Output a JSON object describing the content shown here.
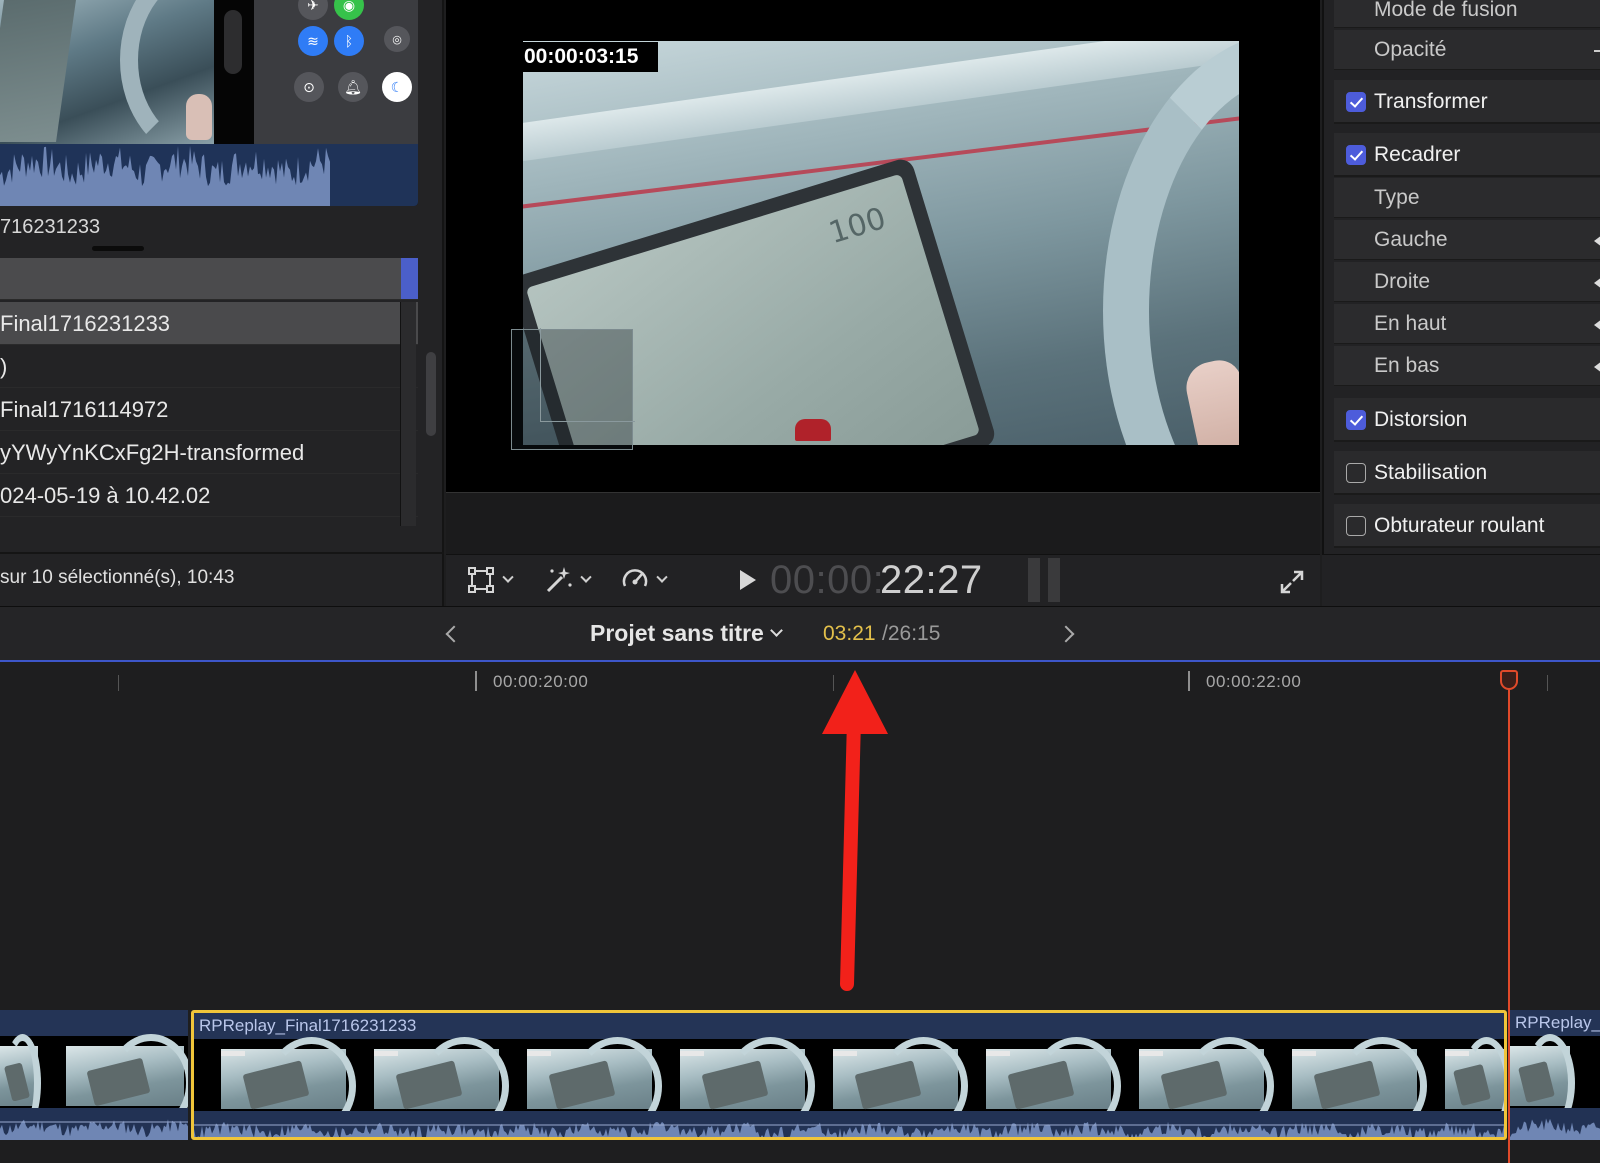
{
  "browser": {
    "clip_name": "716231233",
    "list_items": [
      {
        "label": "Final1716231233",
        "selected": true
      },
      {
        "label": ")",
        "selected": false
      },
      {
        "label": "Final1716114972",
        "selected": false
      },
      {
        "label": "yYWyYnKCxFg2H-transformed",
        "selected": false
      },
      {
        "label": "024-05-19 à 10.42.02",
        "selected": false
      }
    ],
    "status": "sur 10 sélectionné(s), 10:43"
  },
  "viewer": {
    "overlay_timecode": "00:00:03:15",
    "speed_readout": "100",
    "timecode_dim": "00:00:",
    "timecode_bright": "22:27"
  },
  "inspector": {
    "rows": [
      {
        "label": "Mode de fusion",
        "type": "sub"
      },
      {
        "label": "Opacité",
        "type": "sub"
      },
      {
        "label": "Transformer",
        "type": "section",
        "checked": true
      },
      {
        "label": "Recadrer",
        "type": "section",
        "checked": true
      },
      {
        "label": "Type",
        "type": "sub"
      },
      {
        "label": "Gauche",
        "type": "sub"
      },
      {
        "label": "Droite",
        "type": "sub"
      },
      {
        "label": "En haut",
        "type": "sub"
      },
      {
        "label": "En bas",
        "type": "sub"
      },
      {
        "label": "Distorsion",
        "type": "section",
        "checked": true
      },
      {
        "label": "Stabilisation",
        "type": "section",
        "checked": false
      },
      {
        "label": "Obturateur roulant",
        "type": "section",
        "checked": false
      }
    ]
  },
  "timeline": {
    "project_title": "Projet sans titre",
    "tc_current": "03:21",
    "tc_total": "/26:15",
    "ruler_labels": [
      "00:00:20:00",
      "00:00:22:00"
    ],
    "clips": {
      "main": "RPReplay_Final1716231233",
      "right": "RPReplay_"
    }
  },
  "colors": {
    "accent_blue": "#4d5cdb",
    "playhead": "#e04a2a",
    "selection_yellow": "#f0c53a",
    "timecode_yellow": "#e3c04b",
    "annotation_red": "#f2211a"
  }
}
